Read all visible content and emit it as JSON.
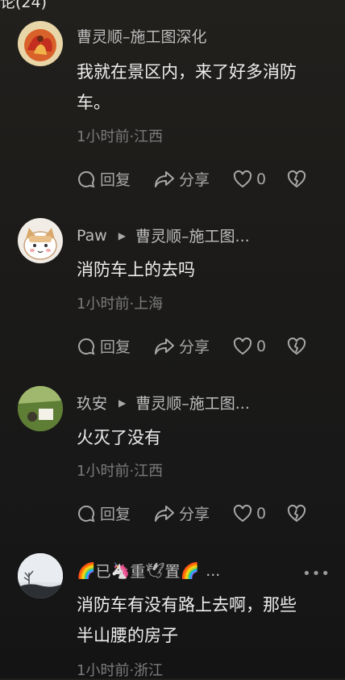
{
  "header": {
    "cut_title": "论(24)"
  },
  "actions_labels": {
    "reply": "回复",
    "share": "分享"
  },
  "comments": [
    {
      "author": "曹灵顺–施工图深化",
      "text_line1": "我就在景区内，来了好多消防",
      "text_line2": "车。",
      "meta": "1小时前·江西",
      "likes": "0"
    },
    {
      "author": "Paw",
      "reply_to": "曹灵顺–施工图...",
      "text": "消防车上的去吗",
      "meta": "1小时前·上海",
      "likes": "0"
    },
    {
      "author": "玖安",
      "reply_to": "曹灵顺–施工图...",
      "text": "火灭了没有",
      "meta": "1小时前·江西",
      "likes": "0"
    },
    {
      "author_parts": [
        "🌈",
        "已",
        "🦄",
        "重",
        "🕊",
        "置",
        "🌈"
      ],
      "author_ellipsis": "...",
      "text_line1": "消防车有没有路上去啊，那些",
      "text_line2": "半山腰的房子",
      "meta": "1小时前·浙江",
      "more": "•••"
    }
  ],
  "icons": [
    "reply-bubble-icon",
    "share-arrow-icon",
    "heart-icon",
    "broken-heart-icon",
    "play-triangle-icon",
    "more-icon"
  ]
}
